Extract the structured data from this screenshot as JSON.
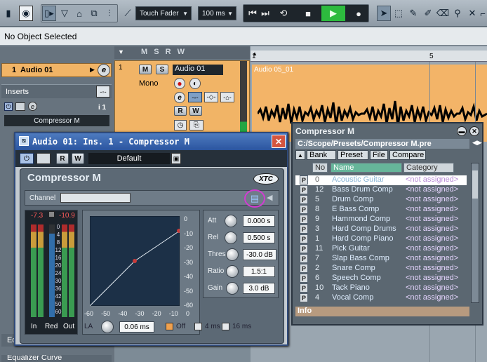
{
  "toolbar": {
    "automation_mode": "Touch Fader",
    "cross_fade": "100 ms"
  },
  "infoline": {
    "status": "No Object Selected"
  },
  "inspector": {
    "track_number": "1",
    "track_name": "Audio 01",
    "inserts_label": "Inserts",
    "insert_slot_number": "i 1",
    "insert_slot_name": "Compressor M",
    "eq_label": "Eq",
    "eq_curve_label": "Equalizer Curve"
  },
  "tracklist": {
    "columns": [
      "M",
      "S",
      "R",
      "W"
    ],
    "track_number": "1",
    "track_name": "Audio 01",
    "mono_label": "Mono"
  },
  "arrange": {
    "ruler_start": "1",
    "ruler_mark": "5",
    "event_name": "Audio 05_01"
  },
  "plugin": {
    "title": "Audio 01: Ins. 1 - Compressor M",
    "preset": "Default",
    "panel_title": "Compressor M",
    "brand": "XTC",
    "channel_label": "Channel",
    "meter_in_peak": "-7.3",
    "meter_out_peak": "-10.9",
    "meter_labels": [
      "In",
      "Red",
      "Out"
    ],
    "meter_scale": [
      "0",
      "4",
      "8",
      "12",
      "16",
      "20",
      "24",
      "30",
      "36",
      "42",
      "50",
      "60"
    ],
    "graph_y_ticks": [
      "0",
      "-10",
      "-20",
      "-30",
      "-40",
      "-50",
      "-60"
    ],
    "graph_x_ticks": [
      "-60",
      "-50",
      "-40",
      "-30",
      "-20",
      "-10",
      "0"
    ],
    "params": [
      {
        "label": "Att",
        "value": "0.000 s"
      },
      {
        "label": "Rel",
        "value": "0.500 s"
      },
      {
        "label": "Thres",
        "value": "-30.0 dB"
      },
      {
        "label": "Ratio",
        "value": "1.5:1"
      },
      {
        "label": "Gain",
        "value": "3.0 dB"
      }
    ],
    "la_label": "LA",
    "la_value": "0.06 ms",
    "la_options": [
      "Off",
      "4 ms",
      "16 ms"
    ]
  },
  "browser": {
    "title": "Compressor M",
    "path": "C:/Scope/Presets/Compressor M.pre",
    "tabs": [
      "Bank",
      "Preset",
      "File",
      "Compare"
    ],
    "columns": [
      "No",
      "Name",
      "Category"
    ],
    "presets": [
      {
        "no": "0",
        "name": "Acoustic Guitar",
        "category": "<not assigned>"
      },
      {
        "no": "12",
        "name": "Bass Drum Comp",
        "category": "<not assigned>"
      },
      {
        "no": "5",
        "name": "Drum Comp",
        "category": "<not assigned>"
      },
      {
        "no": "8",
        "name": "E Bass Comp",
        "category": "<not assigned>"
      },
      {
        "no": "9",
        "name": "Hammond Comp",
        "category": "<not assigned>"
      },
      {
        "no": "3",
        "name": "Hard Comp Drums",
        "category": "<not assigned>"
      },
      {
        "no": "1",
        "name": "Hard Comp Piano",
        "category": "<not assigned>"
      },
      {
        "no": "11",
        "name": "Pick Guitar",
        "category": "<not assigned>"
      },
      {
        "no": "7",
        "name": "Slap Bass Comp",
        "category": "<not assigned>"
      },
      {
        "no": "2",
        "name": "Snare Comp",
        "category": "<not assigned>"
      },
      {
        "no": "6",
        "name": "Speech Comp",
        "category": "<not assigned>"
      },
      {
        "no": "10",
        "name": "Tack Piano",
        "category": "<not assigned>"
      },
      {
        "no": "4",
        "name": "Vocal Comp",
        "category": "<not assigned>"
      }
    ],
    "info_label": "Info",
    "p_label": "P"
  }
}
